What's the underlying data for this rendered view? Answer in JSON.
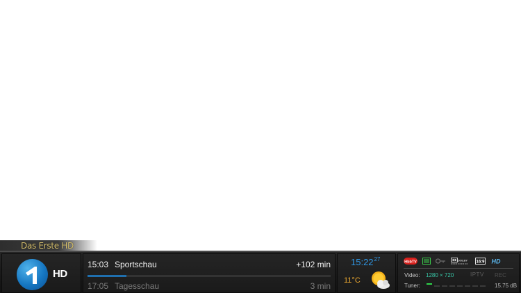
{
  "channel": {
    "name": "Das Erste HD",
    "logo_badge": "HD"
  },
  "epg": {
    "now": {
      "time": "15:03",
      "title": "Sportschau",
      "remaining": "+102 min",
      "progress": 0.16
    },
    "next": {
      "time": "17:05",
      "title": "Tagesschau",
      "duration": "3 min"
    }
  },
  "clock": {
    "time": "15:22",
    "seconds": "27"
  },
  "weather": {
    "temperature": "11°C",
    "icon": "sun-cloud-icon"
  },
  "info": {
    "badges": [
      "hbbtv-icon",
      "subtitle-icon",
      "crypt-key-icon",
      "dolby-digital-icon",
      "aspect-16-9-icon",
      "hd-badge"
    ],
    "badge_texts": {
      "hbbtv": "HbbTV",
      "aspect": "16:9",
      "hd": "HD",
      "dolby": "DOLBY"
    },
    "video_label": "Video:",
    "resolution": "1280 × 720",
    "source": "IPTV",
    "rec": "REC",
    "tuner_label": "Tuner:",
    "signal": "15.75 dB",
    "signal_level_segments": 1,
    "signal_total_segments": 8
  },
  "colors": {
    "accent_blue": "#2f98e6",
    "temp_orange": "#e8a630",
    "resolution_teal": "#39c8a8",
    "channel_gold": "#d8c270"
  }
}
